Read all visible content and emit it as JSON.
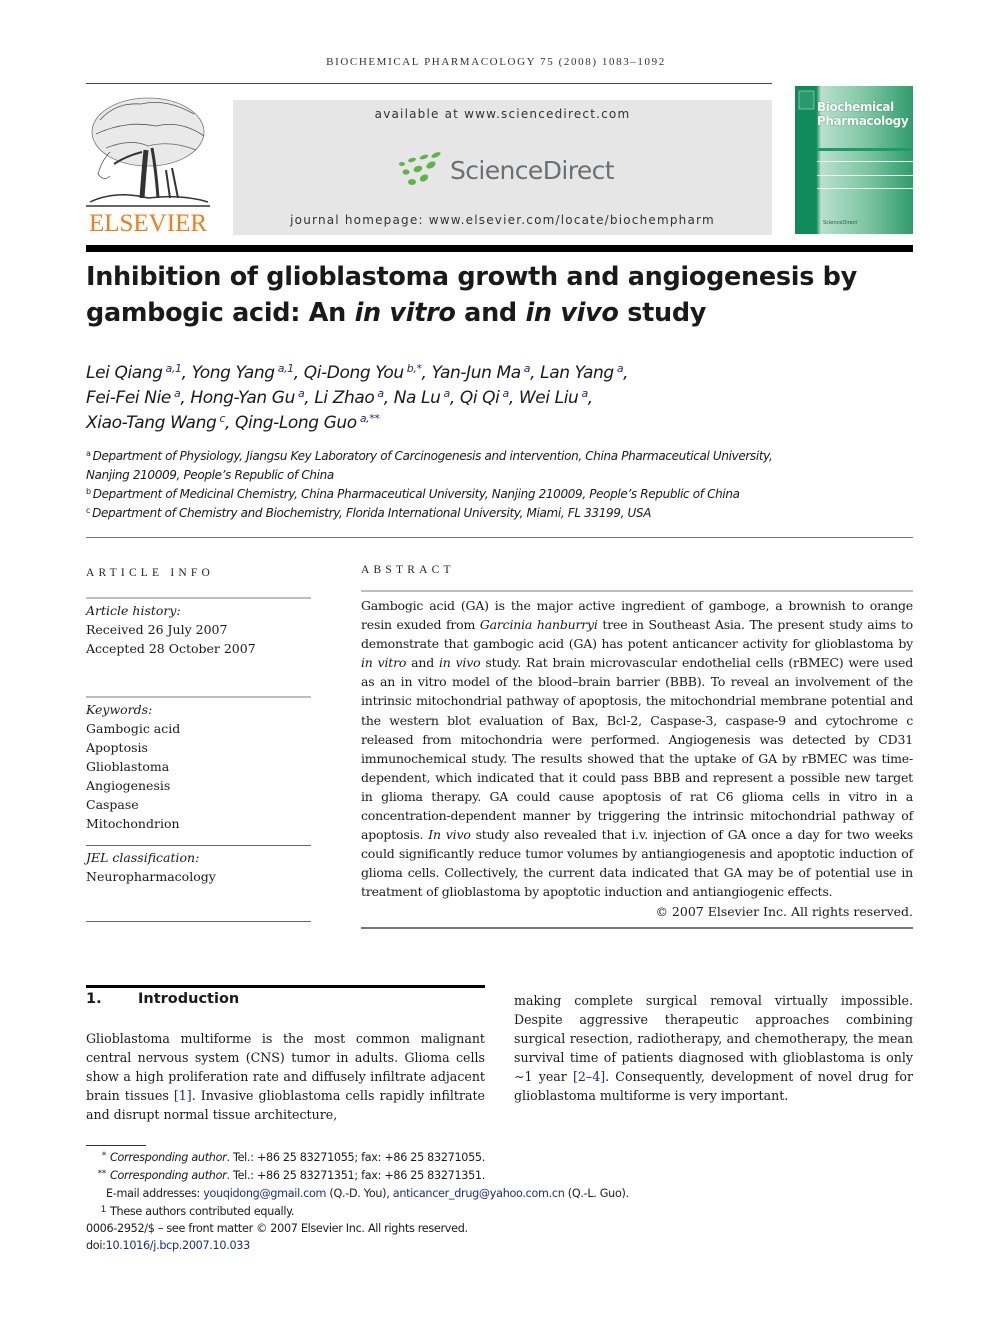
{
  "header": {
    "running_head": "BIOCHEMICAL PHARMACOLOGY 75 (2008) 1083–1092",
    "publisher_wordmark": "ELSEVIER",
    "sd_available": "available at www.sciencedirect.com",
    "sd_brand": "ScienceDirect",
    "journal_homepage": "journal homepage: www.elsevier.com/locate/biochempharm",
    "cover_title_line1": "Biochemical",
    "cover_title_line2": "Pharmacology",
    "cover_footer": "ScienceDirect",
    "colors": {
      "elsevier_orange": "#f07c1a",
      "sd_green": "#5bb645",
      "cover_green": "#0f8a5a",
      "link_blue": "#1d2a8a"
    }
  },
  "article": {
    "title_part1": "Inhibition of glioblastoma growth and angiogenesis by gambogic acid: An ",
    "title_italic1": "in vitro",
    "title_part2": " and ",
    "title_italic2": "in vivo",
    "title_part3": " study",
    "authors": [
      {
        "name": "Lei Qiang",
        "aff": "a,1"
      },
      {
        "name": "Yong Yang",
        "aff": "a,1"
      },
      {
        "name": "Qi-Dong You",
        "aff": "b,*"
      },
      {
        "name": "Yan-Jun Ma",
        "aff": "a"
      },
      {
        "name": "Lan Yang",
        "aff": "a"
      },
      {
        "name": "Fei-Fei Nie",
        "aff": "a"
      },
      {
        "name": "Hong-Yan Gu",
        "aff": "a"
      },
      {
        "name": "Li Zhao",
        "aff": "a"
      },
      {
        "name": "Na Lu",
        "aff": "a"
      },
      {
        "name": "Qi Qi",
        "aff": "a"
      },
      {
        "name": "Wei Liu",
        "aff": "a"
      },
      {
        "name": "Xiao-Tang Wang",
        "aff": "c"
      },
      {
        "name": "Qing-Long Guo",
        "aff": "a,**"
      }
    ],
    "affiliations": [
      {
        "mark": "a",
        "line1": "Department of Physiology, Jiangsu Key Laboratory of Carcinogenesis and intervention, China Pharmaceutical University,",
        "line2": "Nanjing 210009, People’s Republic of China"
      },
      {
        "mark": "b",
        "line1": "Department of Medicinal Chemistry, China Pharmaceutical University, Nanjing 210009, People’s Republic of China"
      },
      {
        "mark": "c",
        "line1": "Department of Chemistry and Biochemistry, Florida International University, Miami, FL 33199, USA"
      }
    ]
  },
  "article_info": {
    "heading": "ARTICLE INFO",
    "history_label": "Article history:",
    "received": "Received 26 July 2007",
    "accepted": "Accepted 28 October 2007",
    "keywords_label": "Keywords:",
    "keywords": [
      "Gambogic acid",
      "Apoptosis",
      "Glioblastoma",
      "Angiogenesis",
      "Caspase",
      "Mitochondrion"
    ],
    "jel_label": "JEL classification:",
    "jel": "Neuropharmacology"
  },
  "abstract": {
    "heading": "ABSTRACT",
    "s1": "Gambogic acid (GA) is the major active ingredient of gamboge, a brownish to orange resin exuded from ",
    "s1_italic": "Garcinia hanburryi",
    "s2": " tree in Southeast Asia. The present study aims to demonstrate that gambogic acid (GA) has potent anticancer activity for glioblastoma by ",
    "s2_italic": "in vitro",
    "s3": " and ",
    "s3_italic": "in vivo",
    "s4": " study. Rat brain microvascular endothelial cells (rBMEC) were used as an in vitro model of the blood–brain barrier (BBB). To reveal an involvement of the intrinsic mitochondrial pathway of apoptosis, the mitochondrial membrane potential and the western blot evaluation of Bax, Bcl-2, Caspase-3, caspase-9 and cytochrome c released from mitochondria were performed. Angiogenesis was detected by CD31 immunochemical study. The results showed that the uptake of GA by rBMEC was time-dependent, which indicated that it could pass BBB and represent a possible new target in glioma therapy. GA could cause apoptosis of rat C6 glioma cells in vitro in a concentration-dependent manner by triggering the intrinsic mitochondrial pathway of apoptosis. ",
    "s4_italic": "In vivo",
    "s5": " study also revealed that i.v. injection of GA once a day for two weeks could significantly reduce tumor volumes by antiangiogenesis and apoptotic induction of glioma cells. Collectively, the current data indicated that GA may be of potential use in treatment of glioblastoma by apoptotic induction and antiangiogenic effects.",
    "copyright": "© 2007 Elsevier Inc. All rights reserved."
  },
  "introduction": {
    "number": "1.",
    "heading": "Introduction",
    "p1_a": "Glioblastoma multiforme is the most common malignant central nervous system (CNS) tumor in adults. Glioma cells show a high proliferation rate and diffusely infiltrate adjacent brain tissues ",
    "p1_cite1": "[1]",
    "p1_b": ". Invasive glioblastoma cells rapidly infiltrate and disrupt normal tissue architecture,",
    "p2_a": "making complete surgical removal virtually impossible. Despite aggressive therapeutic approaches combining surgical resection, radiotherapy, and chemotherapy, the mean survival time of patients diagnosed with glioblastoma is only ∼1 year ",
    "p2_cite": "[2–4]",
    "p2_b": ". Consequently, development of novel drug for glioblastoma multiforme is very important."
  },
  "footnotes": {
    "fn1_mark": "*",
    "fn1_label": "Corresponding author",
    "fn1_text": ". Tel.: +86 25 83271055; fax: +86 25 83271055.",
    "fn2_mark": "**",
    "fn2_label": "Corresponding author",
    "fn2_text": ". Tel.: +86 25 83271351; fax: +86 25 83271351.",
    "email_label": "E-mail addresses: ",
    "email1": "youqidong@gmail.com",
    "email1_owner": " (Q.-D. You), ",
    "email2": "anticancer_drug@yahoo.com.cn",
    "email2_owner": " (Q.-L. Guo).",
    "fn3_mark": "1",
    "fn3_text": "These authors contributed equally.",
    "front_matter": "0006-2952/$ – see front matter © 2007 Elsevier Inc. All rights reserved.",
    "doi_label": "doi:",
    "doi": "10.1016/j.bcp.2007.10.033"
  }
}
